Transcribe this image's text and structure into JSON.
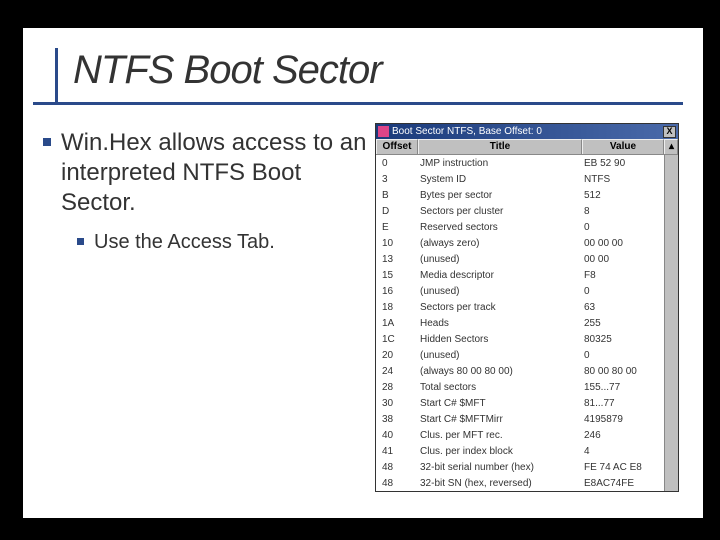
{
  "slide": {
    "title": "NTFS Boot Sector",
    "bullet1": "Win.Hex allows access to an interpreted NTFS Boot Sector.",
    "subbullet1": "Use the Access Tab."
  },
  "winhex": {
    "title": "Boot Sector NTFS, Base Offset: 0",
    "close": "X",
    "headers": {
      "offset": "Offset",
      "title": "Title",
      "value": "Value"
    },
    "rows": [
      {
        "offset": "0",
        "title": "JMP instruction",
        "value": "EB 52 90"
      },
      {
        "offset": "3",
        "title": "System ID",
        "value": "NTFS"
      },
      {
        "offset": "B",
        "title": "Bytes per sector",
        "value": "512"
      },
      {
        "offset": "D",
        "title": "Sectors per cluster",
        "value": "8"
      },
      {
        "offset": "E",
        "title": "Reserved sectors",
        "value": "0"
      },
      {
        "offset": "10",
        "title": "(always zero)",
        "value": "00 00 00"
      },
      {
        "offset": "13",
        "title": "(unused)",
        "value": "00 00"
      },
      {
        "offset": "15",
        "title": "Media descriptor",
        "value": "F8"
      },
      {
        "offset": "16",
        "title": "(unused)",
        "value": "0"
      },
      {
        "offset": "18",
        "title": "Sectors per track",
        "value": "63"
      },
      {
        "offset": "1A",
        "title": "Heads",
        "value": "255"
      },
      {
        "offset": "1C",
        "title": "Hidden Sectors",
        "value": "80325"
      },
      {
        "offset": "20",
        "title": "(unused)",
        "value": "0"
      },
      {
        "offset": "24",
        "title": "(always 80 00 80 00)",
        "value": "80 00 80 00"
      },
      {
        "offset": "28",
        "title": "Total sectors",
        "value": "155...77"
      },
      {
        "offset": "30",
        "title": "Start C# $MFT",
        "value": "81...77"
      },
      {
        "offset": "38",
        "title": "Start C# $MFTMirr",
        "value": "4195879"
      },
      {
        "offset": "40",
        "title": "Clus. per MFT rec.",
        "value": "246"
      },
      {
        "offset": "41",
        "title": "Clus. per index block",
        "value": "4"
      },
      {
        "offset": "48",
        "title": "32-bit serial number (hex)",
        "value": "FE 74 AC E8"
      },
      {
        "offset": "48",
        "title": "32-bit SN (hex, reversed)",
        "value": "E8AC74FE"
      }
    ]
  }
}
